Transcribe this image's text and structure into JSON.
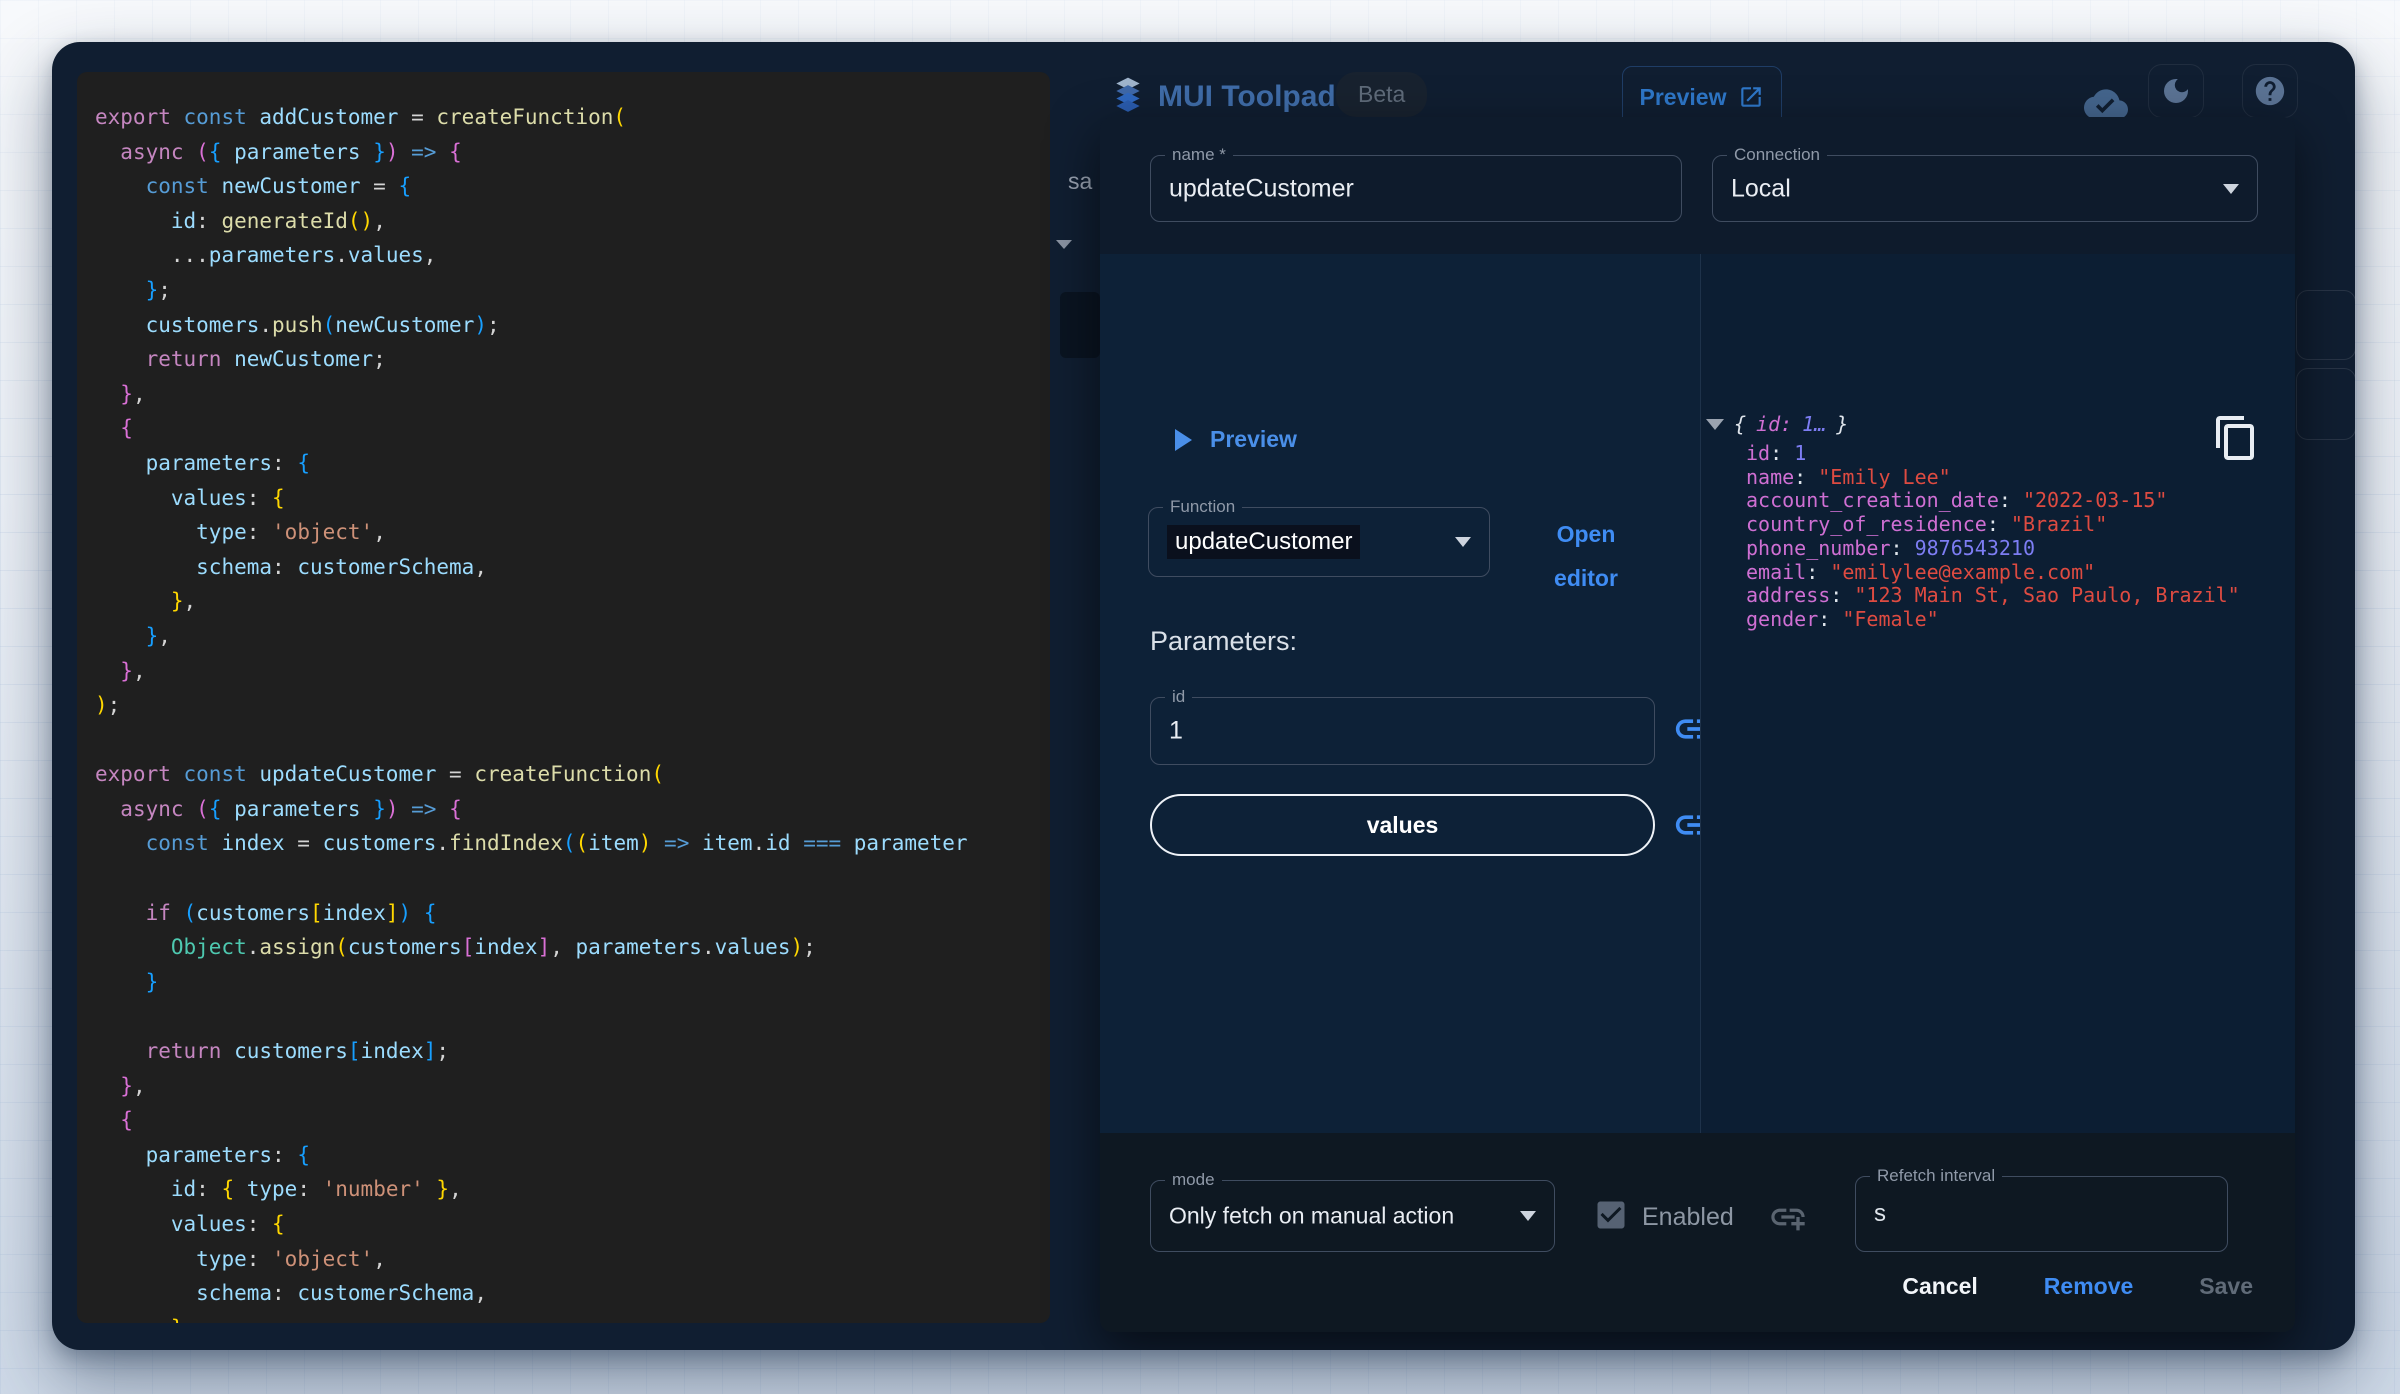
{
  "header": {
    "app_title": "MUI Toolpad",
    "beta_label": "Beta",
    "preview_button_label": "Preview",
    "occluded_text": "sa"
  },
  "colors": {
    "accent_blue": "#3f8cf3",
    "window_bg": "#101e31",
    "editor_bg": "#1f1f1f",
    "dialog_left_bg": "#0d2137",
    "dialog_right_bg": "#0c1e33",
    "result_key": "#cf6fd3",
    "result_string": "#de4b41",
    "result_number": "#7d7df3"
  },
  "code_editor": {
    "lines": [
      [
        [
          "k",
          "export "
        ],
        [
          "c",
          "const "
        ],
        [
          "v",
          "addCustomer "
        ],
        [
          "p",
          "= "
        ],
        [
          "f",
          "createFunction"
        ],
        [
          "b1",
          "("
        ]
      ],
      [
        [
          "p",
          "  "
        ],
        [
          "k",
          "async "
        ],
        [
          "b2",
          "("
        ],
        [
          "b3",
          "{ "
        ],
        [
          "v",
          "parameters"
        ],
        [
          "b3",
          " }"
        ],
        [
          "b2",
          ")"
        ],
        [
          "p",
          " "
        ],
        [
          "c",
          "=>"
        ],
        [
          "p",
          " "
        ],
        [
          "b2",
          "{"
        ]
      ],
      [
        [
          "p",
          "    "
        ],
        [
          "c",
          "const "
        ],
        [
          "v",
          "newCustomer "
        ],
        [
          "p",
          "= "
        ],
        [
          "b3",
          "{"
        ]
      ],
      [
        [
          "p",
          "      "
        ],
        [
          "v",
          "id"
        ],
        [
          "p",
          ": "
        ],
        [
          "f",
          "generateId"
        ],
        [
          "b1",
          "()"
        ],
        [
          "p",
          ","
        ]
      ],
      [
        [
          "p",
          "      ..."
        ],
        [
          "v",
          "parameters"
        ],
        [
          "p",
          "."
        ],
        [
          "v",
          "values"
        ],
        [
          "p",
          ","
        ]
      ],
      [
        [
          "p",
          "    "
        ],
        [
          "b3",
          "}"
        ],
        [
          "p",
          ";"
        ]
      ],
      [
        [
          "p",
          "    "
        ],
        [
          "v",
          "customers"
        ],
        [
          "p",
          "."
        ],
        [
          "f",
          "push"
        ],
        [
          "b3",
          "("
        ],
        [
          "v",
          "newCustomer"
        ],
        [
          "b3",
          ")"
        ],
        [
          "p",
          ";"
        ]
      ],
      [
        [
          "p",
          "    "
        ],
        [
          "k",
          "return "
        ],
        [
          "v",
          "newCustomer"
        ],
        [
          "p",
          ";"
        ]
      ],
      [
        [
          "p",
          "  "
        ],
        [
          "b2",
          "}"
        ],
        [
          "p",
          ","
        ]
      ],
      [
        [
          "p",
          "  "
        ],
        [
          "b2",
          "{"
        ]
      ],
      [
        [
          "p",
          "    "
        ],
        [
          "v",
          "parameters"
        ],
        [
          "p",
          ": "
        ],
        [
          "b3",
          "{"
        ]
      ],
      [
        [
          "p",
          "      "
        ],
        [
          "v",
          "values"
        ],
        [
          "p",
          ": "
        ],
        [
          "b1",
          "{"
        ]
      ],
      [
        [
          "p",
          "        "
        ],
        [
          "v",
          "type"
        ],
        [
          "p",
          ": "
        ],
        [
          "s",
          "'object'"
        ],
        [
          "p",
          ","
        ]
      ],
      [
        [
          "p",
          "        "
        ],
        [
          "v",
          "schema"
        ],
        [
          "p",
          ": "
        ],
        [
          "v",
          "customerSchema"
        ],
        [
          "p",
          ","
        ]
      ],
      [
        [
          "p",
          "      "
        ],
        [
          "b1",
          "}"
        ],
        [
          "p",
          ","
        ]
      ],
      [
        [
          "p",
          "    "
        ],
        [
          "b3",
          "}"
        ],
        [
          "p",
          ","
        ]
      ],
      [
        [
          "p",
          "  "
        ],
        [
          "b2",
          "}"
        ],
        [
          "p",
          ","
        ]
      ],
      [
        [
          "b1",
          ")"
        ],
        [
          "p",
          ";"
        ]
      ],
      [],
      [
        [
          "k",
          "export "
        ],
        [
          "c",
          "const "
        ],
        [
          "v",
          "updateCustomer "
        ],
        [
          "p",
          "= "
        ],
        [
          "f",
          "createFunction"
        ],
        [
          "b1",
          "("
        ]
      ],
      [
        [
          "p",
          "  "
        ],
        [
          "k",
          "async "
        ],
        [
          "b2",
          "("
        ],
        [
          "b3",
          "{ "
        ],
        [
          "v",
          "parameters"
        ],
        [
          "b3",
          " }"
        ],
        [
          "b2",
          ")"
        ],
        [
          "p",
          " "
        ],
        [
          "c",
          "=>"
        ],
        [
          "p",
          " "
        ],
        [
          "b2",
          "{"
        ]
      ],
      [
        [
          "p",
          "    "
        ],
        [
          "c",
          "const "
        ],
        [
          "v",
          "index "
        ],
        [
          "p",
          "= "
        ],
        [
          "v",
          "customers"
        ],
        [
          "p",
          "."
        ],
        [
          "f",
          "findIndex"
        ],
        [
          "b3",
          "("
        ],
        [
          "b1",
          "("
        ],
        [
          "v",
          "item"
        ],
        [
          "b1",
          ")"
        ],
        [
          "p",
          " "
        ],
        [
          "c",
          "=>"
        ],
        [
          "p",
          " "
        ],
        [
          "v",
          "item"
        ],
        [
          "p",
          "."
        ],
        [
          "v",
          "id"
        ],
        [
          "p",
          " "
        ],
        [
          "c",
          "==="
        ],
        [
          "p",
          " "
        ],
        [
          "v",
          "parameter"
        ]
      ],
      [],
      [
        [
          "p",
          "    "
        ],
        [
          "k",
          "if "
        ],
        [
          "b3",
          "("
        ],
        [
          "v",
          "customers"
        ],
        [
          "b1",
          "["
        ],
        [
          "v",
          "index"
        ],
        [
          "b1",
          "]"
        ],
        [
          "b3",
          ")"
        ],
        [
          "p",
          " "
        ],
        [
          "b3",
          "{"
        ]
      ],
      [
        [
          "p",
          "      "
        ],
        [
          "t",
          "Object"
        ],
        [
          "p",
          "."
        ],
        [
          "f",
          "assign"
        ],
        [
          "b1",
          "("
        ],
        [
          "v",
          "customers"
        ],
        [
          "b2",
          "["
        ],
        [
          "v",
          "index"
        ],
        [
          "b2",
          "]"
        ],
        [
          "p",
          ", "
        ],
        [
          "v",
          "parameters"
        ],
        [
          "p",
          "."
        ],
        [
          "v",
          "values"
        ],
        [
          "b1",
          ")"
        ],
        [
          "p",
          ";"
        ]
      ],
      [
        [
          "p",
          "    "
        ],
        [
          "b3",
          "}"
        ]
      ],
      [],
      [
        [
          "p",
          "    "
        ],
        [
          "k",
          "return "
        ],
        [
          "v",
          "customers"
        ],
        [
          "b3",
          "["
        ],
        [
          "v",
          "index"
        ],
        [
          "b3",
          "]"
        ],
        [
          "p",
          ";"
        ]
      ],
      [
        [
          "p",
          "  "
        ],
        [
          "b2",
          "}"
        ],
        [
          "p",
          ","
        ]
      ],
      [
        [
          "p",
          "  "
        ],
        [
          "b2",
          "{"
        ]
      ],
      [
        [
          "p",
          "    "
        ],
        [
          "v",
          "parameters"
        ],
        [
          "p",
          ": "
        ],
        [
          "b3",
          "{"
        ]
      ],
      [
        [
          "p",
          "      "
        ],
        [
          "v",
          "id"
        ],
        [
          "p",
          ": "
        ],
        [
          "b1",
          "{ "
        ],
        [
          "v",
          "type"
        ],
        [
          "p",
          ": "
        ],
        [
          "s",
          "'number'"
        ],
        [
          "b1",
          " }"
        ],
        [
          "p",
          ","
        ]
      ],
      [
        [
          "p",
          "      "
        ],
        [
          "v",
          "values"
        ],
        [
          "p",
          ": "
        ],
        [
          "b1",
          "{"
        ]
      ],
      [
        [
          "p",
          "        "
        ],
        [
          "v",
          "type"
        ],
        [
          "p",
          ": "
        ],
        [
          "s",
          "'object'"
        ],
        [
          "p",
          ","
        ]
      ],
      [
        [
          "p",
          "        "
        ],
        [
          "v",
          "schema"
        ],
        [
          "p",
          ": "
        ],
        [
          "v",
          "customerSchema"
        ],
        [
          "p",
          ","
        ]
      ],
      [
        [
          "p",
          "      "
        ],
        [
          "b1",
          "}"
        ],
        [
          "p",
          ","
        ]
      ]
    ]
  },
  "dialog": {
    "name_field": {
      "label": "name *",
      "value": "updateCustomer"
    },
    "connection_field": {
      "label": "Connection",
      "value": "Local"
    },
    "preview_section": {
      "label": "Preview"
    },
    "function_field": {
      "label": "Function",
      "value": "updateCustomer"
    },
    "open_editor_button": "Open editor",
    "parameters_heading": "Parameters:",
    "id_field": {
      "label": "id",
      "value": "1"
    },
    "values_button": "values",
    "result_viewer": {
      "root_preview": {
        "open": "{",
        "key": "id:",
        "value": " 1…",
        "close": "}"
      },
      "entries": [
        {
          "key": "id",
          "value": "1",
          "kind": "number"
        },
        {
          "key": "name",
          "value": "\"Emily Lee\"",
          "kind": "string"
        },
        {
          "key": "account_creation_date",
          "value": "\"2022-03-15\"",
          "kind": "string"
        },
        {
          "key": "country_of_residence",
          "value": "\"Brazil\"",
          "kind": "string"
        },
        {
          "key": "phone_number",
          "value": "9876543210",
          "kind": "number"
        },
        {
          "key": "email",
          "value": "\"emilylee@example.com\"",
          "kind": "string"
        },
        {
          "key": "address",
          "value": "\"123 Main St, Sao Paulo, Brazil\"",
          "kind": "string"
        },
        {
          "key": "gender",
          "value": "\"Female\"",
          "kind": "string"
        }
      ]
    },
    "footer": {
      "mode_field": {
        "label": "mode",
        "value": "Only fetch on manual action"
      },
      "enabled_checkbox": {
        "label": "Enabled",
        "checked": true
      },
      "refetch_field": {
        "label": "Refetch interval",
        "value": "s"
      },
      "cancel_button": "Cancel",
      "remove_button": "Remove",
      "save_button": "Save"
    }
  }
}
